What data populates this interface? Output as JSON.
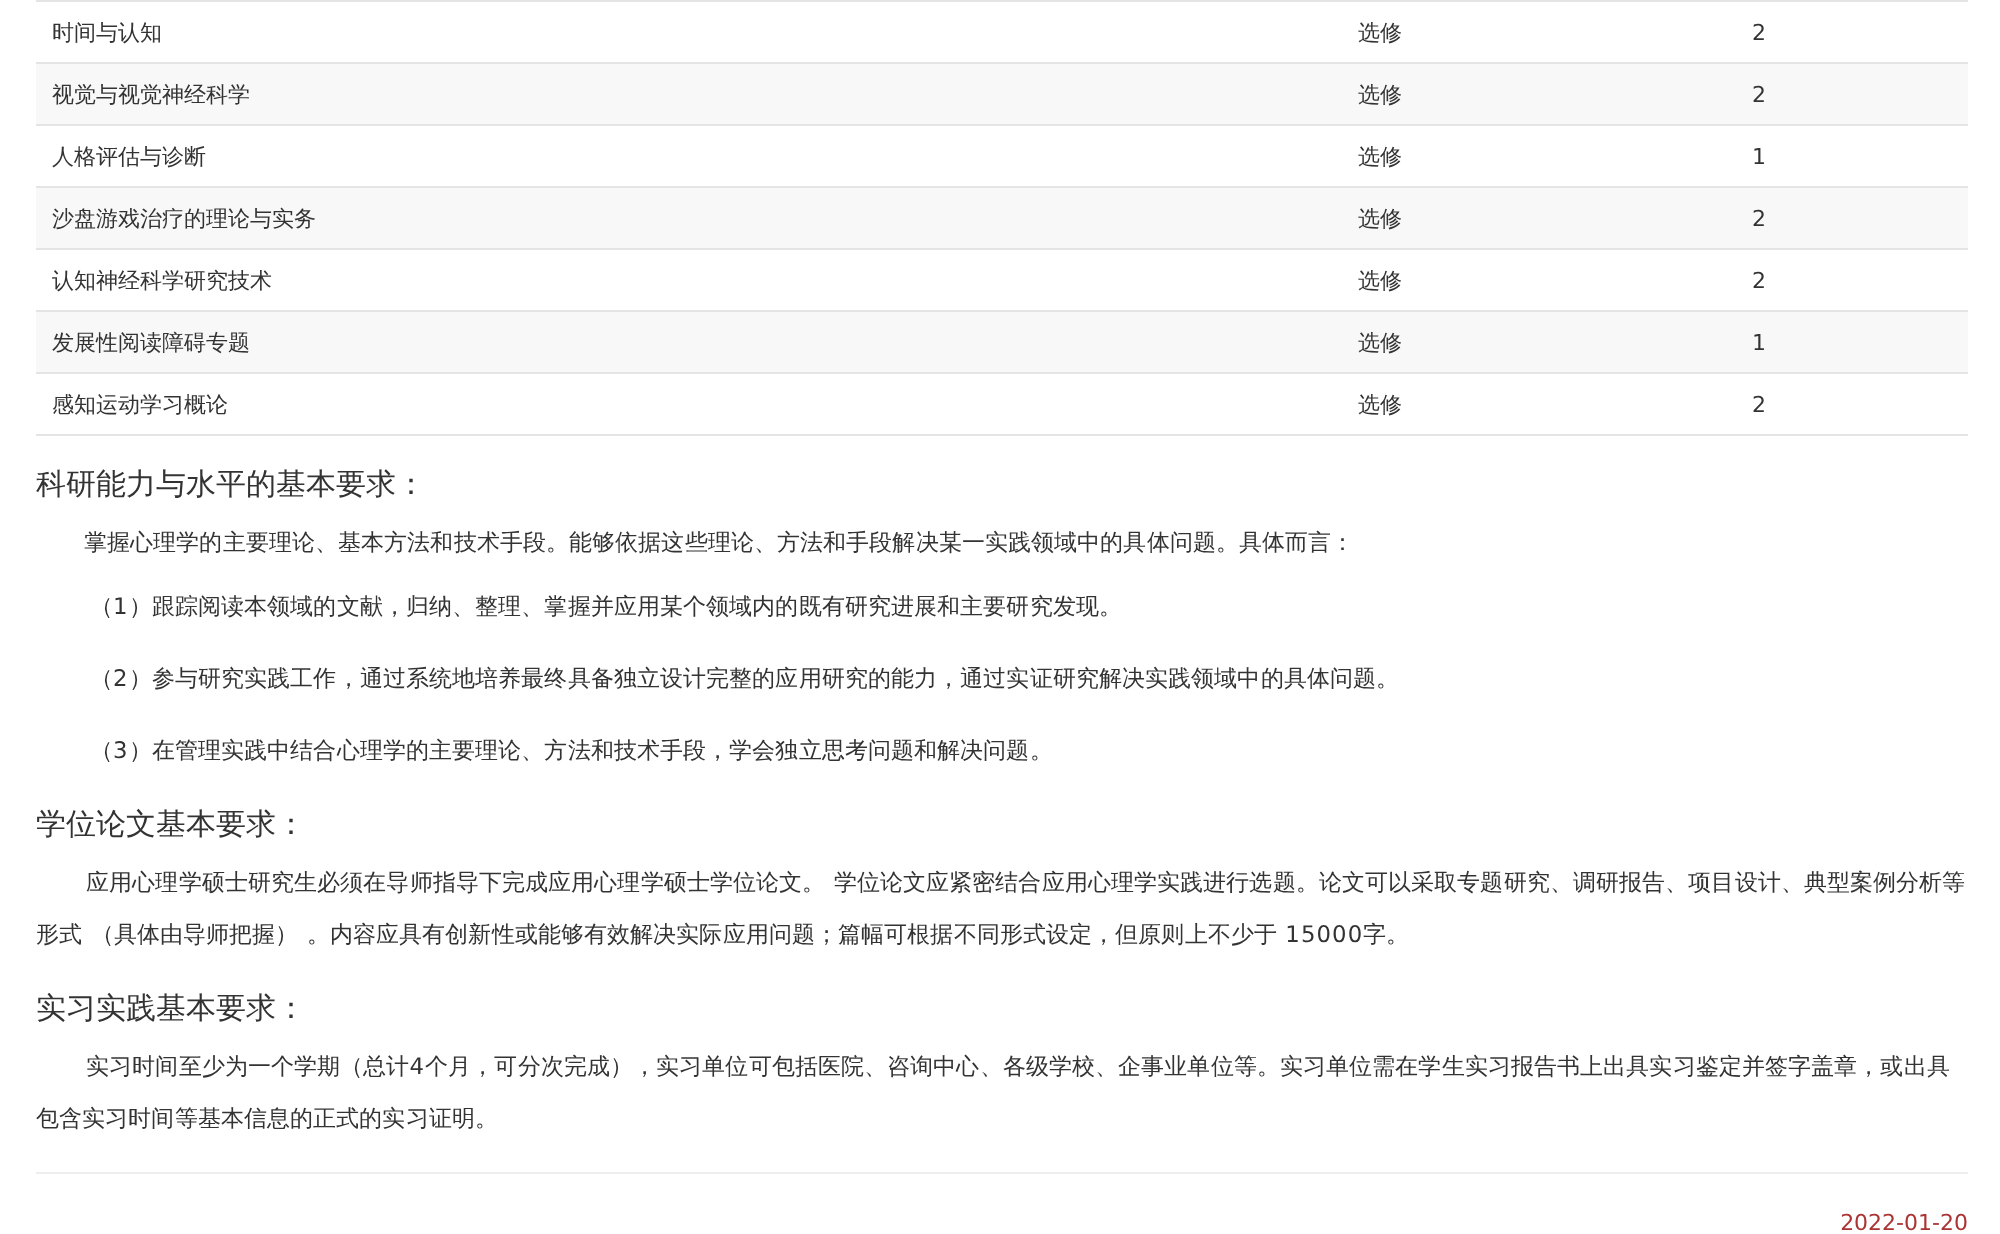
{
  "courses": [
    {
      "name": "时间与认知",
      "type": "选修",
      "credits": "2"
    },
    {
      "name": "视觉与视觉神经科学",
      "type": "选修",
      "credits": "2"
    },
    {
      "name": "人格评估与诊断",
      "type": "选修",
      "credits": "1"
    },
    {
      "name": "沙盘游戏治疗的理论与实务",
      "type": "选修",
      "credits": "2"
    },
    {
      "name": "认知神经科学研究技术",
      "type": "选修",
      "credits": "2"
    },
    {
      "name": "发展性阅读障碍专题",
      "type": "选修",
      "credits": "1"
    },
    {
      "name": "感知运动学习概论",
      "type": "选修",
      "credits": "2"
    }
  ],
  "sections": [
    {
      "heading": "科研能力与水平的基本要求：",
      "paragraphs": [
        {
          "kind": "intro",
          "text": "掌握心理学的主要理论、基本方法和技术手段。能够依据这些理论、方法和手段解决某一实践领域中的具体问题。具体而言："
        },
        {
          "kind": "item",
          "text": "（1）跟踪阅读本领域的文献，归纳、整理、掌握并应用某个领域内的既有研究进展和主要研究发现。"
        },
        {
          "kind": "item",
          "text": "（2）参与研究实践工作，通过系统地培养最终具备独立设计完整的应用研究的能力，通过实证研究解决实践领域中的具体问题。"
        },
        {
          "kind": "item",
          "text": "（3）在管理实践中结合心理学的主要理论、方法和技术手段，学会独立思考问题和解决问题。"
        }
      ]
    },
    {
      "heading": "学位论文基本要求：",
      "paragraphs": [
        {
          "kind": "body",
          "text": "应用心理学硕士研究生必须在导师指导下完成应用心理学硕士学位论文。 学位论文应紧密结合应用心理学实践进行选题。论文可以采取专题研究、调研报告、项目设计、典型案例分析等形式 （具体由导师把握） 。内容应具有创新性或能够有效解决实际应用问题；篇幅可根据不同形式设定，但原则上不少于 15000字。"
        }
      ]
    },
    {
      "heading": "实习实践基本要求：",
      "paragraphs": [
        {
          "kind": "body",
          "text": "实习时间至少为一个学期（总计4个月，可分次完成），实习单位可包括医院、咨询中心、各级学校、企事业单位等。实习单位需在学生实习报告书上出具实习鉴定并签字盖章，或出具包含实习时间等基本信息的正式的实习证明。"
        }
      ]
    }
  ],
  "date": "2022-01-20"
}
